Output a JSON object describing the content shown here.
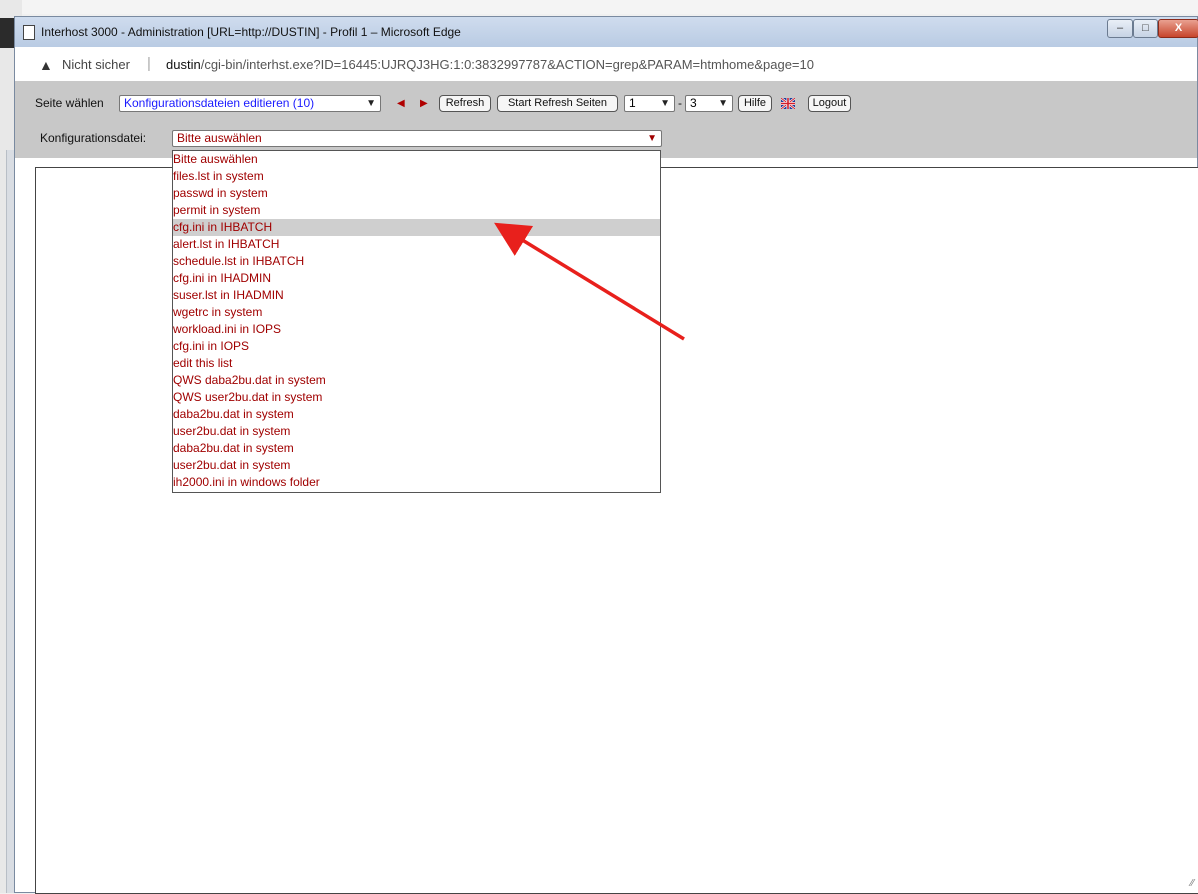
{
  "window": {
    "title": "Interhost 3000 - Administration [URL=http://DUSTIN] - Profil 1 – Microsoft Edge",
    "min_glyph": "–",
    "max_glyph": "□",
    "close_glyph": "X"
  },
  "address_bar": {
    "warning_icon": "warning-icon",
    "insecure_label": "Nicht sicher",
    "separator": "|",
    "host": "dustin",
    "path": "/cgi-bin/interhst.exe?ID=16445:UJRQJ3HG:1:0:3832997787&ACTION=grep&PARAM=htmhome&page=10"
  },
  "toolbar": {
    "page_label": "Seite wählen",
    "page_select_value": "Konfigurationsdateien editieren (10)",
    "prev_glyph": "◀",
    "next_glyph": "▶",
    "refresh_label": "Refresh",
    "start_refresh_label": "Start Refresh Seiten",
    "range_from": "1",
    "range_dash": "-",
    "range_to": "3",
    "help_label": "Hilfe",
    "language_icon": "uk-flag-icon",
    "logout_label": "Logout"
  },
  "config": {
    "label": "Konfigurationsdatei:",
    "select_value": "Bitte auswählen",
    "options": [
      "Bitte auswählen",
      "files.lst in system",
      "passwd in system",
      "permit in system",
      "cfg.ini in IHBATCH",
      "alert.lst in IHBATCH",
      "schedule.lst in IHBATCH",
      "cfg.ini in IHADMIN",
      "suser.lst in IHADMIN",
      "wgetrc in system",
      "workload.ini in IOPS",
      "cfg.ini in IOPS",
      "edit this list",
      "QWS daba2bu.dat in system",
      "QWS user2bu.dat in system",
      "daba2bu.dat in system",
      "user2bu.dat in system",
      "daba2bu.dat in system",
      "user2bu.dat in system",
      "ih2000.ini in windows folder"
    ],
    "highlighted_index": 4
  },
  "colors": {
    "option_text": "#a00000",
    "page_select_text": "#1a1aff",
    "annotation_arrow": "#e8201c"
  }
}
